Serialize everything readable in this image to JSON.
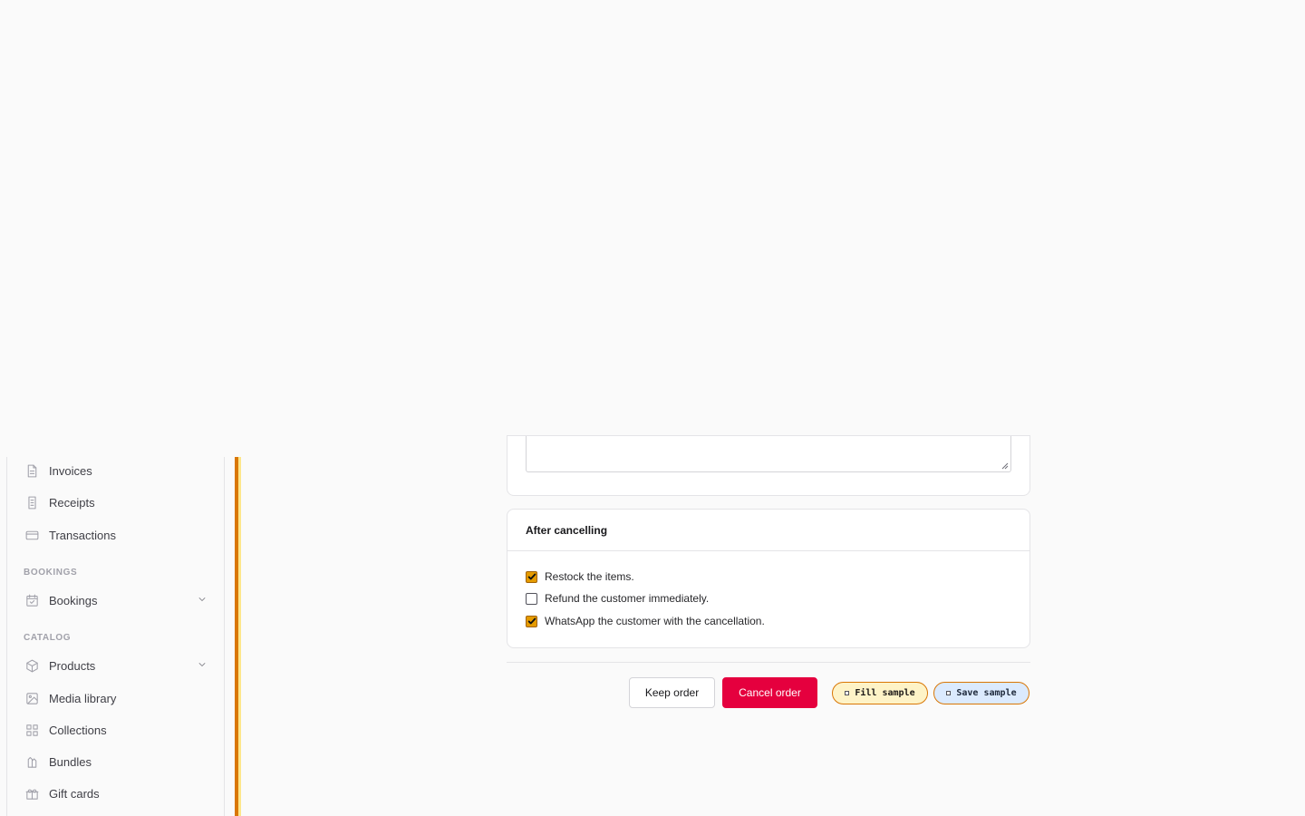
{
  "sidebar": {
    "items_top": [
      {
        "label": "Invoices",
        "icon": "document-icon"
      },
      {
        "label": "Receipts",
        "icon": "receipt-icon"
      },
      {
        "label": "Transactions",
        "icon": "credit-card-icon"
      }
    ],
    "sections": [
      {
        "heading": "BOOKINGS",
        "items": [
          {
            "label": "Bookings",
            "icon": "calendar-check-icon",
            "expandable": true
          }
        ]
      },
      {
        "heading": "CATALOG",
        "items": [
          {
            "label": "Products",
            "icon": "cube-icon",
            "expandable": true
          },
          {
            "label": "Media library",
            "icon": "image-icon"
          },
          {
            "label": "Collections",
            "icon": "grid-icon"
          },
          {
            "label": "Bundles",
            "icon": "bundle-icon"
          },
          {
            "label": "Gift cards",
            "icon": "gift-icon"
          }
        ]
      }
    ]
  },
  "after_cancelling": {
    "title": "After cancelling",
    "options": [
      {
        "label": "Restock the items.",
        "checked": true
      },
      {
        "label": "Refund the customer immediately.",
        "checked": false
      },
      {
        "label": "WhatsApp the customer with the cancellation.",
        "checked": true
      }
    ]
  },
  "actions": {
    "keep_label": "Keep order",
    "cancel_label": "Cancel order",
    "fill_sample_label": "Fill sample",
    "save_sample_label": "Save sample"
  },
  "colors": {
    "accent": "#d97706",
    "danger": "#e5003e",
    "checkbox": "#e59b00"
  }
}
